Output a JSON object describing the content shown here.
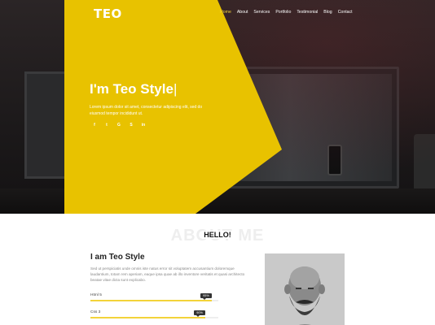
{
  "header": {
    "logo": "TEO",
    "nav": [
      "Home",
      "About",
      "Services",
      "Portfolio",
      "Testimonial",
      "Blog",
      "Contact"
    ],
    "active": "Home"
  },
  "hero": {
    "greeting": "I'm ",
    "name": "Teo Style",
    "cursor": "|",
    "description": "Lorem ipsum dolor sit amet, consectetur adipiscing elit, sed do eiusmod tempor incididunt ut.",
    "social_icons": [
      "facebook-icon",
      "twitter-icon",
      "google-icon",
      "skype-icon",
      "linkedin-icon"
    ],
    "social_glyphs": [
      "f",
      "t",
      "G",
      "S",
      "in"
    ]
  },
  "about": {
    "background_title": "ABOUT ME",
    "hello": "HELLO!",
    "name": "I am Teo Style",
    "text": "Sed ut perspiciatis unde omnis iste natus error sit voluptatem accusantium doloremque laudantium, totam rem aperiam, eaque ipsa quae ab illo inventore veritatis et quasi architecto beatae vitae dicta sunt explicabo.",
    "skills": [
      {
        "label": "Html 5",
        "percent": 95,
        "badge": "95%"
      },
      {
        "label": "Css 3",
        "percent": 90,
        "badge": "90%"
      }
    ]
  },
  "colors": {
    "accent": "#f3d33a",
    "triangle": "#e8c200"
  }
}
